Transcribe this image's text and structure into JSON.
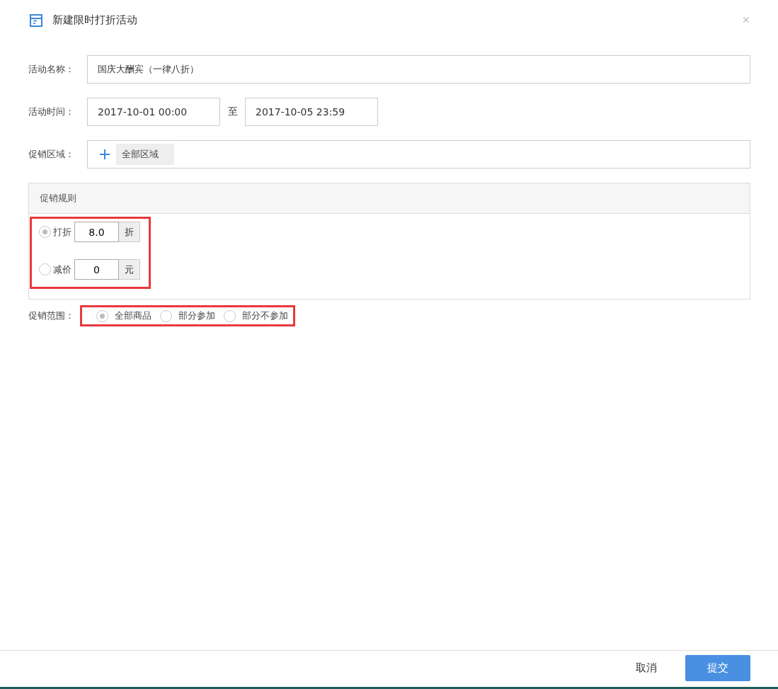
{
  "dialog": {
    "title": "新建限时打折活动",
    "close": "×"
  },
  "form": {
    "name": {
      "label": "活动名称：",
      "value": "国庆大酬宾（一律八折）"
    },
    "time": {
      "label": "活动时间：",
      "start": "2017-10-01 00:00",
      "separator": "至",
      "end": "2017-10-05 23:59"
    },
    "region": {
      "label": "促销区域：",
      "tags": [
        "全部区域"
      ]
    }
  },
  "rules": {
    "title": "促销规则",
    "options": [
      {
        "label": "打折",
        "value": "8.0",
        "unit": "折",
        "selected": true
      },
      {
        "label": "减价",
        "value": "0",
        "unit": "元",
        "selected": false
      }
    ]
  },
  "scope": {
    "label": "促销范围：",
    "options": [
      {
        "label": "全部商品",
        "selected": true
      },
      {
        "label": "部分参加",
        "selected": false
      },
      {
        "label": "部分不参加",
        "selected": false
      }
    ]
  },
  "footer": {
    "cancel": "取消",
    "submit": "提交"
  }
}
